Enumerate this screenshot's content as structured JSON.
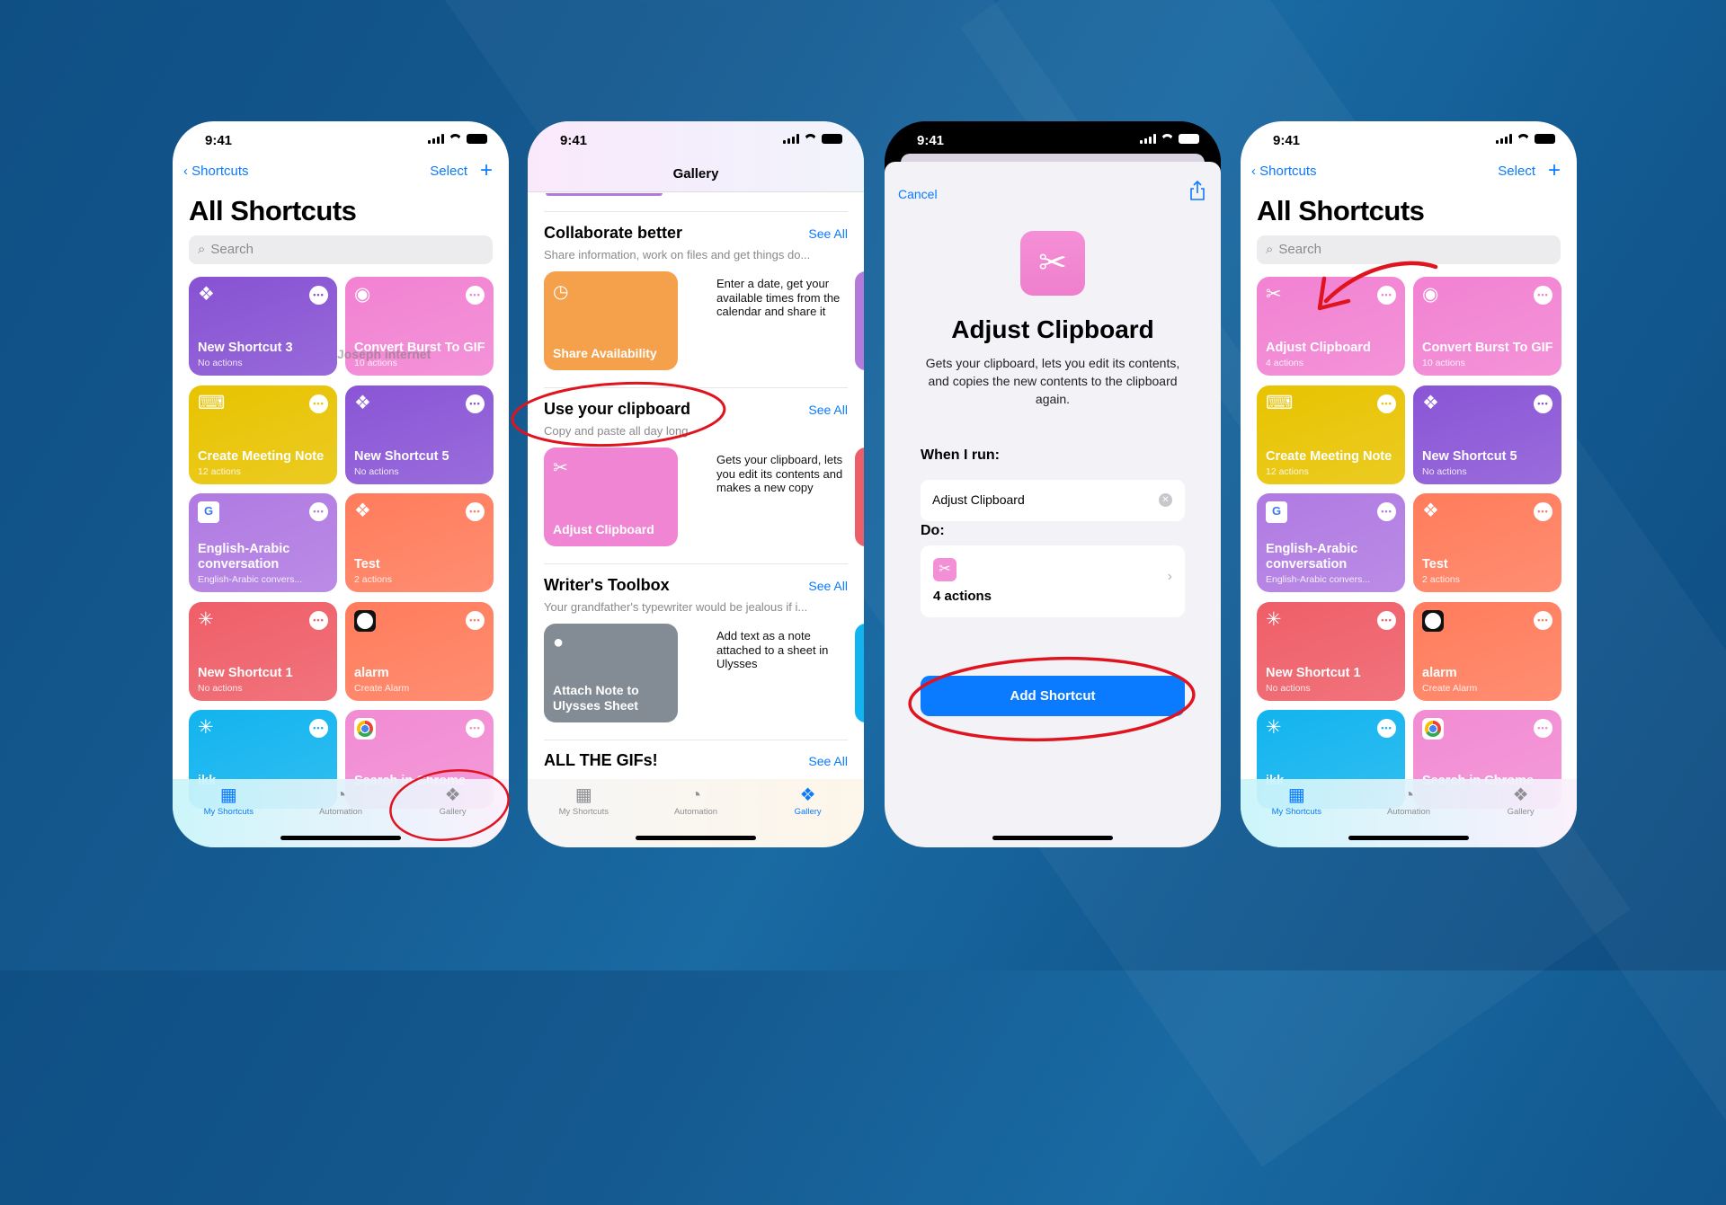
{
  "colors": {
    "background": "#14598f",
    "accent": "#0a7aff",
    "annotation": "#e0141e"
  },
  "status": {
    "time": "9:41"
  },
  "shortcuts_screen": {
    "back": "Shortcuts",
    "select": "Select",
    "add": "+",
    "title": "All Shortcuts",
    "search_placeholder": "Search"
  },
  "watermark": "Joseph internet",
  "tabs": [
    {
      "label": "My Shortcuts",
      "icon": "grid-icon"
    },
    {
      "label": "Automation",
      "icon": "automation-clock-icon"
    },
    {
      "label": "Gallery",
      "icon": "layers-icon"
    }
  ],
  "phone1_tiles": [
    {
      "name": "New Shortcut 3",
      "sub": "No actions",
      "color": "#8752d3",
      "icon": "layers-icon"
    },
    {
      "name": "Convert Burst To GIF",
      "sub": "10 actions",
      "color": "#f282d2",
      "icon": "target-icon"
    },
    {
      "name": "Create Meeting Note",
      "sub": "12 actions",
      "color": "#e8c300",
      "icon": "keyboard-icon"
    },
    {
      "name": "New Shortcut 5",
      "sub": "No actions",
      "color": "#8a55d6",
      "icon": "layers-icon"
    },
    {
      "name": "English-Arabic conversation",
      "sub": "English-Arabic convers...",
      "color": "#b07ae2",
      "icon": "translate-icon"
    },
    {
      "name": "Test",
      "sub": "2 actions",
      "color": "#ff7c5c",
      "icon": "layers-icon"
    },
    {
      "name": "New Shortcut 1",
      "sub": "No actions",
      "color": "#ef5e68",
      "icon": "sparkle-icon"
    },
    {
      "name": "alarm",
      "sub": "Create Alarm",
      "color": "#ff7c5c",
      "icon": "clock-icon"
    },
    {
      "name": "ikk",
      "sub": "",
      "color": "#12b4ef",
      "icon": "sparkle-icon"
    },
    {
      "name": "Search in Chrome",
      "sub": "",
      "color": "#f28bd3",
      "icon": "chrome-icon"
    }
  ],
  "phone4_tiles": [
    {
      "name": "Adjust Clipboard",
      "sub": "4 actions",
      "color": "#f282d2",
      "icon": "scissors-icon"
    },
    {
      "name": "Convert Burst To GIF",
      "sub": "10 actions",
      "color": "#f282d2",
      "icon": "target-icon"
    },
    {
      "name": "Create Meeting Note",
      "sub": "12 actions",
      "color": "#e8c300",
      "icon": "keyboard-icon"
    },
    {
      "name": "New Shortcut 5",
      "sub": "No actions",
      "color": "#8a55d6",
      "icon": "layers-icon"
    },
    {
      "name": "English-Arabic conversation",
      "sub": "English-Arabic convers...",
      "color": "#b07ae2",
      "icon": "translate-icon"
    },
    {
      "name": "Test",
      "sub": "2 actions",
      "color": "#ff7c5c",
      "icon": "layers-icon"
    },
    {
      "name": "New Shortcut 1",
      "sub": "No actions",
      "color": "#ef5e68",
      "icon": "sparkle-icon"
    },
    {
      "name": "alarm",
      "sub": "Create Alarm",
      "color": "#ff7c5c",
      "icon": "clock-icon"
    },
    {
      "name": "ikk",
      "sub": "",
      "color": "#12b4ef",
      "icon": "sparkle-icon"
    },
    {
      "name": "Search in Chrome",
      "sub": "",
      "color": "#f28bd3",
      "icon": "chrome-icon"
    }
  ],
  "gallery": {
    "title": "Gallery",
    "sections": [
      {
        "title": "Collaborate better",
        "see_all": "See All",
        "subtitle": "Share information, work on files and get things do...",
        "card_title": "Share Availability",
        "card_desc": "Enter a date, get your available times from the calendar and share it",
        "color": "#f5a04a",
        "peek_color": "#b47ad9",
        "icon": "clock-icon"
      },
      {
        "title": "Use your clipboard",
        "see_all": "See All",
        "subtitle": "Copy and paste all day long",
        "card_title": "Adjust Clipboard",
        "card_desc": "Gets your clipboard, lets you edit its contents and makes a new copy",
        "color": "#f085d3",
        "peek_color": "#ec5f6a",
        "icon": "scissors-icon"
      },
      {
        "title": "Writer's Toolbox",
        "see_all": "See All",
        "subtitle": "Your grandfather's typewriter would be jealous if i...",
        "card_title": "Attach Note to Ulysses Sheet",
        "card_desc": "Add text as a note attached to a sheet in Ulysses",
        "color": "#838b95",
        "peek_color": "#12b4ef",
        "icon": "speech-bubble-icon"
      }
    ],
    "partial_section": {
      "title": "ALL THE GIFs!",
      "see_all": "See All"
    }
  },
  "detail": {
    "cancel": "Cancel",
    "title": "Adjust Clipboard",
    "description": "Gets your clipboard, lets you edit its contents, and copies the new contents to the clipboard again.",
    "when_label": "When I run:",
    "when_value": "Adjust Clipboard",
    "do_label": "Do:",
    "actions": "4 actions",
    "button": "Add Shortcut"
  }
}
